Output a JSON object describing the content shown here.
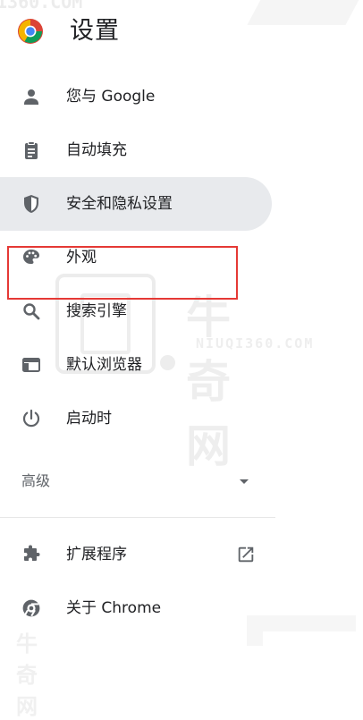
{
  "header": {
    "title": "设置",
    "icon": "chrome-logo-icon"
  },
  "menu": {
    "items": [
      {
        "label": "您与 Google",
        "icon": "person-icon"
      },
      {
        "label": "自动填充",
        "icon": "clipboard-icon"
      },
      {
        "label": "安全和隐私设置",
        "icon": "shield-icon",
        "active": true
      },
      {
        "label": "外观",
        "icon": "palette-icon"
      },
      {
        "label": "搜索引擎",
        "icon": "search-icon"
      },
      {
        "label": "默认浏览器",
        "icon": "browser-icon"
      },
      {
        "label": "启动时",
        "icon": "power-icon"
      }
    ],
    "advanced": {
      "label": "高级",
      "icon": "chevron-down-icon"
    },
    "extensions": {
      "label": "扩展程序",
      "icon": "puzzle-icon",
      "trailing_icon": "open-in-new-icon"
    },
    "about": {
      "label": "关于 Chrome",
      "icon": "chrome-outline-icon"
    }
  },
  "colors": {
    "active_bg": "#e8eaed",
    "text": "#202124",
    "icon": "#5f6368",
    "highlight": "#e53935"
  }
}
